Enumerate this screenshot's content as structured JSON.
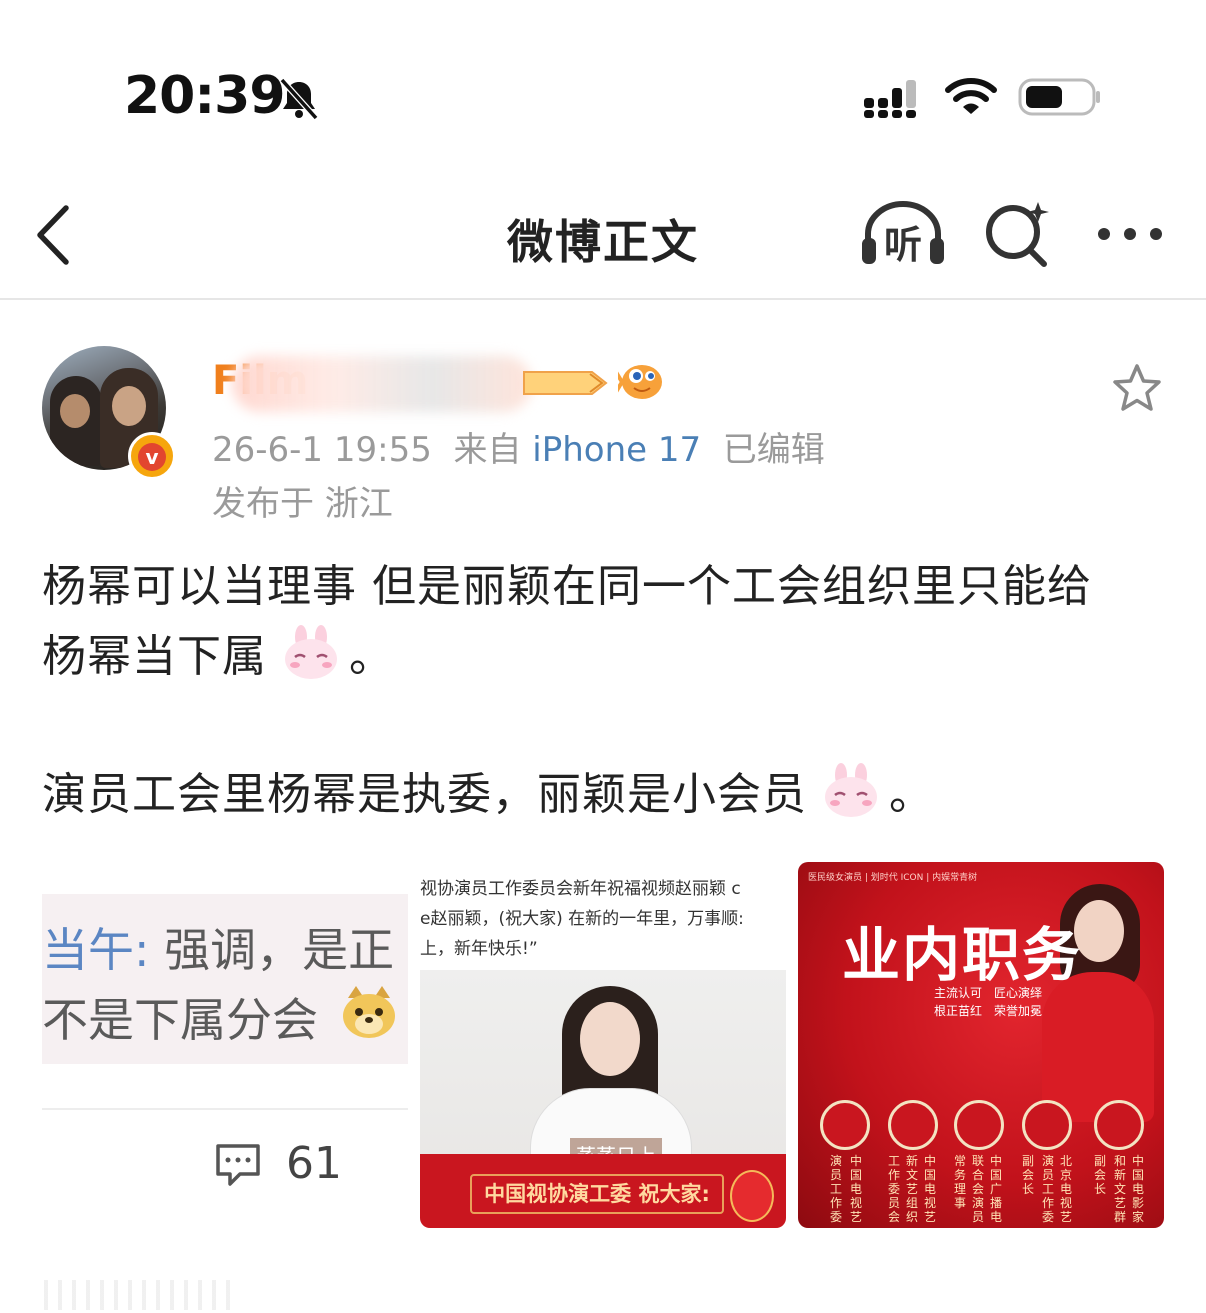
{
  "status_bar": {
    "time": "20:39"
  },
  "nav": {
    "title": "微博正文",
    "listen_label": "听"
  },
  "post": {
    "author": "Film",
    "timestamp": "26-6-1 19:55",
    "source_prefix": "来自",
    "device": "iPhone 17",
    "edited": "已编辑",
    "location": "发布于 浙江",
    "lines": [
      "杨幂可以当理事 但是丽颖在同一个工会组织里只能给",
      "杨幂当下属",
      "。",
      "演员工会里杨幂是执委，丽颖是小会员",
      "。"
    ]
  },
  "images": {
    "img1": {
      "line1_a": "当午:",
      "line1_b": "强调，是正",
      "line2": "不是下属分会"
    },
    "img2": {
      "captions": [
        "视协演员工作委员会新年祝福视频赵丽颖 c",
        "е赵丽颖，(祝大家) 在新的一年里，万事顺:",
        "上，新年快乐!”"
      ],
      "subtitle": "蒸蒸日上",
      "banner": "中国视协演工委 祝大家:"
    },
    "img3": {
      "header": "业内职务",
      "tags": [
        "主流认可",
        "匠心演绎",
        "根正苗红",
        "荣誉加冕"
      ],
      "top_line": "医民级女演员 | 划时代 ICON | 内娱常青树",
      "columns": [
        "演员工作委",
        "中国电视艺",
        "工作委员会",
        "新文艺组织",
        "中国电视艺",
        "常务理事",
        "联合会演员",
        "中国广播电",
        "副会长",
        "演员工作委",
        "北京电视艺",
        "副会长",
        "和新文艺群",
        "中国电影家"
      ]
    }
  },
  "actions": {
    "comment_count": "61"
  },
  "colors": {
    "username": "#f07f1c",
    "device_link": "#4a7fb5",
    "meta_gray": "#9a9a9a"
  }
}
